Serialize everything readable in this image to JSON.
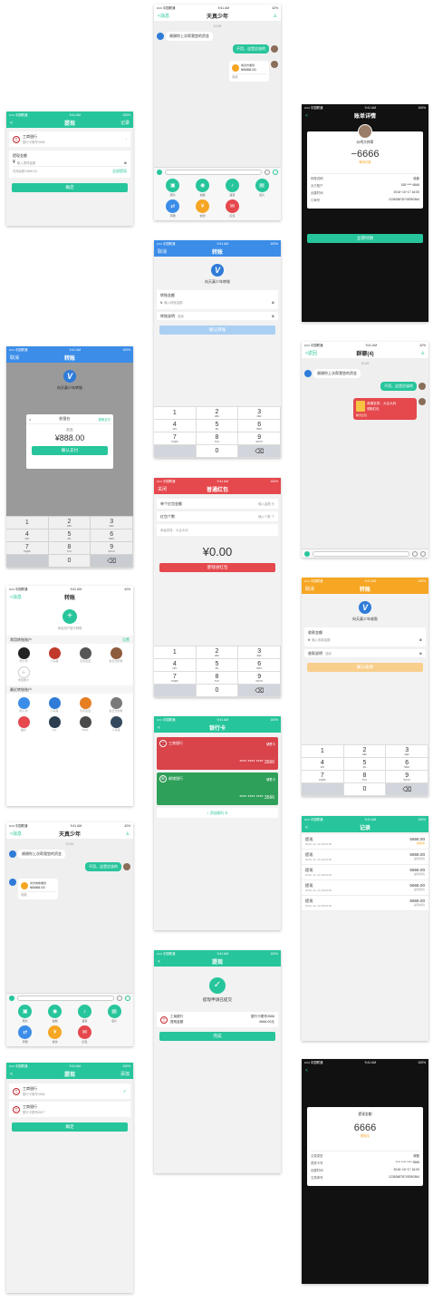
{
  "status": {
    "carrier": "••••• 中国联通",
    "time": "9:41 AM",
    "battery": "100%",
    "battery2": "42%"
  },
  "w1": {
    "back": "<",
    "title": "提现",
    "right": "记录",
    "bank": "工商银行",
    "card": "银行卡尾号3566",
    "amt_label": "提现金额",
    "amt_ph": "输入提现金额",
    "avail": "可用余额 6888.00",
    "all": "全部提现",
    "btn": "确定"
  },
  "w2": {
    "cancel": "取消",
    "title": "转账",
    "to": "向天真少年转账",
    "sheet_title": "收银台",
    "sheet_link": "更换支付",
    "sheet_desc": "红包",
    "amount": "¥888.00",
    "confirm": "确认支付",
    "keys": [
      [
        "1",
        ""
      ],
      [
        "2",
        "ABC"
      ],
      [
        "3",
        "DEF"
      ],
      [
        "4",
        "GHI"
      ],
      [
        "5",
        "JKL"
      ],
      [
        "6",
        "MNO"
      ],
      [
        "7",
        "PQRS"
      ],
      [
        "8",
        "TUV"
      ],
      [
        "9",
        "WXYZ"
      ],
      [
        "",
        ""
      ],
      [
        "0",
        ""
      ],
      [
        "⌫",
        ""
      ]
    ]
  },
  "w3": {
    "back": "<消息",
    "title": "转账",
    "add": "添加用户进行转账",
    "freq": "常用转账账户",
    "set": "设置",
    "recent": "最近转账账户",
    "f": [
      "阿公司",
      "小马哥",
      "天真宝宝",
      "赵日天的象"
    ],
    "addlbl": "添加账户",
    "r": [
      "阿公司",
      "小马哥",
      "天真宝宝",
      "赵日天的象",
      "猫仔",
      "Lily",
      "Stark",
      "小马哥"
    ]
  },
  "w4": {
    "back": "<消息",
    "title": "天真少年",
    "time": "10:45",
    "msg1": "谢谢你上次帮我垫的资金",
    "msg2": "不用，这是应该的",
    "rp_title": "对方向你收款",
    "rp_amt": "¥8888.00",
    "rp_sub": "收款",
    "tiles": [
      "照片",
      "拍摄",
      "语音",
      "名片",
      "转账",
      "收款",
      "红包"
    ]
  },
  "w5": {
    "back": "<",
    "title": "提现",
    "right": "添加",
    "b1": "工商银行",
    "c1": "银行卡尾号3566",
    "b2": "工商银行",
    "c2": "银行卡尾号6877",
    "btn": "确定"
  },
  "c1": {
    "back": "<消息",
    "title": "天真少年",
    "time": "10:45",
    "msg1": "谢谢你上次帮我垫的资金",
    "msg2": "不用，这是应该的",
    "rp_title": "向对方收款",
    "rp_amt": "¥8888.00",
    "rp_sub": "收款",
    "tiles": [
      "照片",
      "拍摄",
      "语音",
      "名片",
      "转账",
      "收款",
      "红包"
    ]
  },
  "c2": {
    "cancel": "取消",
    "title": "转账",
    "to": "向天真少年转账",
    "amt_label": "转账金额",
    "amt_ph": "输入转账金额",
    "note": "转账说明",
    "note_ph": "选填",
    "btn": "确认转账",
    "keys": [
      [
        "1",
        ""
      ],
      [
        "2",
        "ABC"
      ],
      [
        "3",
        "DEF"
      ],
      [
        "4",
        "GHI"
      ],
      [
        "5",
        "JKL"
      ],
      [
        "6",
        "MNO"
      ],
      [
        "7",
        "PQRS"
      ],
      [
        "8",
        "TUV"
      ],
      [
        "9",
        "WXYZ"
      ],
      [
        "",
        ""
      ],
      [
        "0",
        ""
      ],
      [
        "⌫",
        ""
      ]
    ]
  },
  "c3": {
    "close": "关闭",
    "title": "普通红包",
    "r1": "单个红包金额",
    "r1v": "输入金额 元",
    "r2": "红包个数",
    "r2v": "输入个数 个",
    "msg": "恭喜发财，大吉大利",
    "amt": "¥0.00",
    "btn": "塞钱进红包",
    "keys": [
      [
        "1",
        ""
      ],
      [
        "2",
        "ABC"
      ],
      [
        "3",
        "DEF"
      ],
      [
        "4",
        "GHI"
      ],
      [
        "5",
        "JKL"
      ],
      [
        "6",
        "MNO"
      ],
      [
        "7",
        "PQRS"
      ],
      [
        "8",
        "TUV"
      ],
      [
        "9",
        "WXYZ"
      ],
      [
        "",
        ""
      ],
      [
        "0",
        ""
      ],
      [
        "⌫",
        ""
      ]
    ]
  },
  "c4": {
    "back": "<",
    "title": "银行卡",
    "b1": "工商银行",
    "t1": "储蓄卡",
    "n1": "**** **** **** 3566",
    "b2": "邮储银行",
    "t2": "储蓄卡",
    "n2": "**** **** **** 3566",
    "add": "+ 添加银行卡"
  },
  "c5": {
    "back": "<",
    "title": "提现",
    "done": "提现申请已提交",
    "bank": "工商银行",
    "card": "银行卡尾号3566",
    "lbl": "提现金额",
    "amt": "6666.00元",
    "btn": "完成"
  },
  "r1": {
    "back": "<",
    "title": "账单详情",
    "name": "炒鸡大帅哥",
    "amt": "−6666",
    "st": "等待付款",
    "rows": [
      [
        "转账说明",
        "收款"
      ],
      [
        "对方账户",
        "155 **** 6666"
      ],
      [
        "创建时间",
        "2016−10−17 16:00"
      ],
      [
        "订单号",
        "123634878743090364"
      ]
    ],
    "btn": "立即付款"
  },
  "r2": {
    "back": "<返回",
    "title": "群聊(4)",
    "time": "10:45",
    "msg1": "谢谢你上次帮我垫的资金",
    "msg2": "不用，这是应该的",
    "rp1": "恭喜发财，大吉大利",
    "rp2": "领取红包",
    "rp3": "聊天红包"
  },
  "r3": {
    "cancel": "取消",
    "title": "转账",
    "to": "向天真少年收款",
    "amt_label": "收款金额",
    "amt_ph": "输入收款金额",
    "note": "收款说明",
    "note_ph": "选填",
    "btn": "确认收款",
    "keys": [
      [
        "1",
        ""
      ],
      [
        "2",
        "ABC"
      ],
      [
        "3",
        "DEF"
      ],
      [
        "4",
        "GHI"
      ],
      [
        "5",
        "JKL"
      ],
      [
        "6",
        "MNO"
      ],
      [
        "7",
        "PQRS"
      ],
      [
        "8",
        "TUV"
      ],
      [
        "9",
        "WXYZ"
      ],
      [
        "",
        ""
      ],
      [
        "0",
        ""
      ],
      [
        "⌫",
        ""
      ]
    ]
  },
  "r4": {
    "back": "<",
    "title": "记录",
    "items": [
      [
        "提现",
        "2016−11−10 18:00:00",
        "6666.00",
        "提现中"
      ],
      [
        "提现",
        "2016−11−10 18:00:00",
        "6666.00",
        "提现成功"
      ],
      [
        "提现",
        "2016−11−10 18:00:00",
        "6666.00",
        "提现成功"
      ],
      [
        "提现",
        "2016−11−10 18:00:00",
        "6666.00",
        "提现成功"
      ],
      [
        "提现",
        "2016−11−10 18:00:00",
        "6666.00",
        "提现成功"
      ]
    ]
  },
  "r5": {
    "back": "<",
    "lbl": "提现金额",
    "amt": "6666",
    "st": "提现中",
    "rows": [
      [
        "交易类型",
        "转账"
      ],
      [
        "提现卡号",
        "**** **** **** 3566"
      ],
      [
        "创建时间",
        "2016−10−17 16:00"
      ],
      [
        "交易单号",
        "123634878743090364"
      ]
    ]
  },
  "colors": {
    "green": "#27c59b",
    "blue": "#3b8de8",
    "red": "#e5484d",
    "orange": "#f6a623"
  }
}
